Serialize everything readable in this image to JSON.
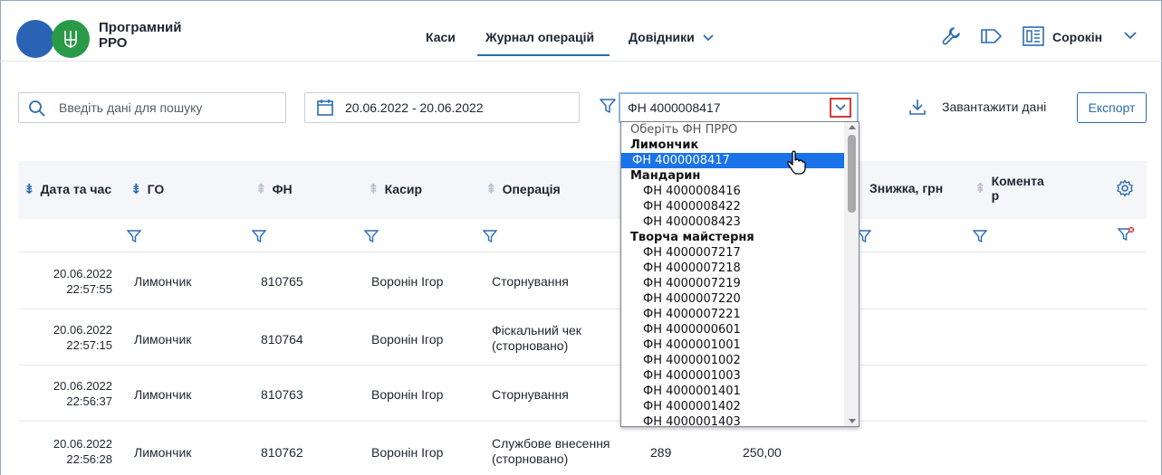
{
  "brand": {
    "title": "Програмний РРО"
  },
  "nav": {
    "items": [
      {
        "label": "Каси"
      },
      {
        "label": "Журнал операцій"
      },
      {
        "label": "Довідники"
      }
    ]
  },
  "user": {
    "name": "Сорокін"
  },
  "toolbar": {
    "search_placeholder": "Введіть дані для пошуку",
    "date_range": "20.06.2022 - 20.06.2022",
    "fn_selected": "ФН 4000008417",
    "download_label": "Завантажити дані",
    "export_label": "Експорт"
  },
  "table": {
    "columns": [
      "Дата та час",
      "ГО",
      "ФН",
      "Касир",
      "Операція",
      "Знижка, грн",
      "Коментар"
    ],
    "comment_col_line1": "Комента",
    "comment_col_line2": "р",
    "rows": [
      {
        "date": "20.06.2022",
        "time": "22:57:55",
        "go": "Лимончик",
        "fn": "810765",
        "cashier": "Воронін Ігор",
        "op1": "Сторнування",
        "op2": "",
        "c6": "",
        "c7": ""
      },
      {
        "date": "20.06.2022",
        "time": "22:57:15",
        "go": "Лимончик",
        "fn": "810764",
        "cashier": "Воронін Ігор",
        "op1": "Фіскальний чек",
        "op2": "(сторновано)",
        "c6": "",
        "c7": ""
      },
      {
        "date": "20.06.2022",
        "time": "22:56:37",
        "go": "Лимончик",
        "fn": "810763",
        "cashier": "Воронін Ігор",
        "op1": "Сторнування",
        "op2": "",
        "c6": "",
        "c7": ""
      },
      {
        "date": "20.06.2022",
        "time": "22:56:28",
        "go": "Лимончик",
        "fn": "810762",
        "cashier": "Воронін Ігор",
        "op1": "Службове внесення",
        "op2": "(сторновано)",
        "c6": "289",
        "c7": "250,00"
      }
    ]
  },
  "dropdown": {
    "items": [
      {
        "kind": "placeholder",
        "label": "Оберіть ФН ПРРО"
      },
      {
        "kind": "group",
        "label": "Лимончик"
      },
      {
        "kind": "selected",
        "label": "ФН 4000008417"
      },
      {
        "kind": "group",
        "label": "Мандарин"
      },
      {
        "kind": "opt",
        "label": "ФН 4000008416"
      },
      {
        "kind": "opt",
        "label": "ФН 4000008422"
      },
      {
        "kind": "opt",
        "label": "ФН 4000008423"
      },
      {
        "kind": "group",
        "label": "Творча майстерня"
      },
      {
        "kind": "opt",
        "label": "ФН 4000007217"
      },
      {
        "kind": "opt",
        "label": "ФН 4000007218"
      },
      {
        "kind": "opt",
        "label": "ФН 4000007219"
      },
      {
        "kind": "opt",
        "label": "ФН 4000007220"
      },
      {
        "kind": "opt",
        "label": "ФН 4000007221"
      },
      {
        "kind": "opt",
        "label": "ФН 4000000601"
      },
      {
        "kind": "opt",
        "label": "ФН 4000001001"
      },
      {
        "kind": "opt",
        "label": "ФН 4000001002"
      },
      {
        "kind": "opt",
        "label": "ФН 4000001003"
      },
      {
        "kind": "opt",
        "label": "ФН 4000001401"
      },
      {
        "kind": "opt",
        "label": "ФН 4000001402"
      },
      {
        "kind": "opt",
        "label": "ФН 4000001403"
      }
    ]
  },
  "colors": {
    "accent": "#2b6cb0",
    "logo_blue": "#2b63b4",
    "logo_green": "#2a9a48",
    "selected": "#1a73e8"
  },
  "icons": [
    "trident-icon",
    "wrench-icon",
    "tag-icon",
    "cash-register-icon",
    "chevron-down-icon",
    "search-icon",
    "calendar-icon",
    "filter-icon",
    "download-icon",
    "settings-icon",
    "sort-icon",
    "filter-clear-icon",
    "cursor-icon"
  ]
}
